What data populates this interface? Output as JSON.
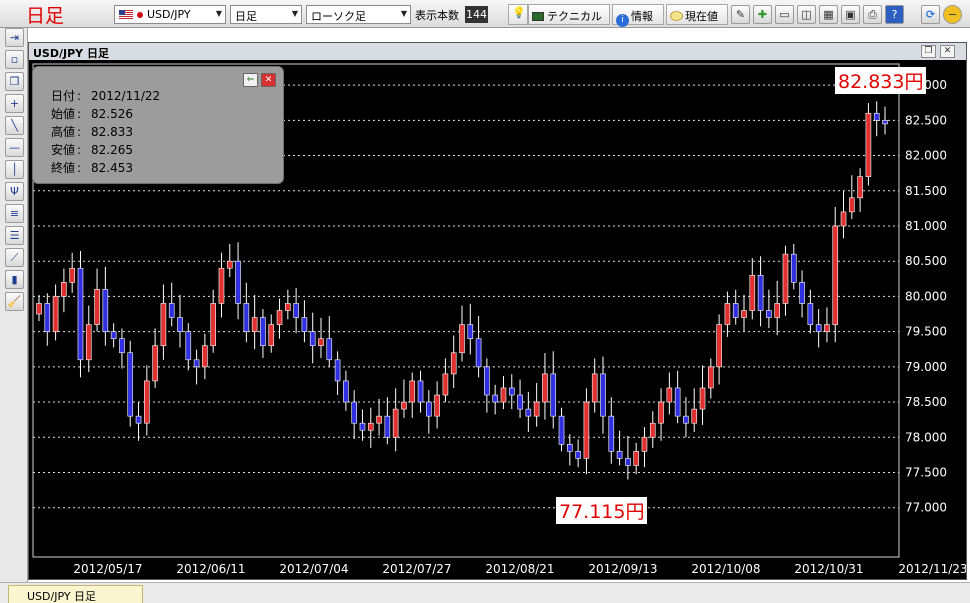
{
  "app": {
    "title": "日足"
  },
  "toolbar": {
    "symbol": "USD/JPY",
    "period": "日足",
    "chart_type": "ローソク足",
    "count_label": "表示本数",
    "count_value": "144",
    "technical_label": "テクニカル",
    "info_label": "情報",
    "current_label": "現在値"
  },
  "chart": {
    "title": "USD/JPY  日足"
  },
  "info_panel": {
    "rows": [
      {
        "key": "日付",
        "value": "2012/11/22"
      },
      {
        "key": "始値",
        "value": "82.526"
      },
      {
        "key": "高値",
        "value": "82.833"
      },
      {
        "key": "安値",
        "value": "82.265"
      },
      {
        "key": "終値",
        "value": "82.453"
      }
    ],
    "separator": ":"
  },
  "annotations": {
    "high_label": "82.833円",
    "low_label": "77.115円"
  },
  "bottom_tab": {
    "label": "USD/JPY  日足"
  },
  "colors": {
    "up": "#e03030",
    "down": "#3030e0",
    "background": "#000000",
    "label": "#e00000"
  },
  "chart_data": {
    "type": "candlestick",
    "ylim": [
      76.3,
      83.3
    ],
    "yticks": [
      "83.000",
      "82.500",
      "82.000",
      "81.500",
      "81.000",
      "80.500",
      "80.000",
      "79.500",
      "79.000",
      "78.500",
      "78.000",
      "77.500",
      "77.000"
    ],
    "xticks": [
      "2012/05/17",
      "2012/06/11",
      "2012/07/04",
      "2012/07/27",
      "2012/08/21",
      "2012/09/13",
      "2012/10/08",
      "2012/10/31",
      "2012/11/23"
    ],
    "closes": [
      79.9,
      79.5,
      80.0,
      80.2,
      80.4,
      79.1,
      79.6,
      80.1,
      79.5,
      79.4,
      79.2,
      78.3,
      78.2,
      78.8,
      79.3,
      79.9,
      79.7,
      79.5,
      79.1,
      79.0,
      79.3,
      79.9,
      80.4,
      80.5,
      79.9,
      79.5,
      79.7,
      79.3,
      79.6,
      79.8,
      79.9,
      79.7,
      79.5,
      79.3,
      79.4,
      79.1,
      78.8,
      78.5,
      78.2,
      78.1,
      78.2,
      78.3,
      78.0,
      78.4,
      78.5,
      78.8,
      78.5,
      78.3,
      78.6,
      78.9,
      79.2,
      79.6,
      79.4,
      79.0,
      78.6,
      78.5,
      78.7,
      78.6,
      78.4,
      78.3,
      78.5,
      78.9,
      78.3,
      77.9,
      77.8,
      77.7,
      78.5,
      78.9,
      78.3,
      77.8,
      77.7,
      77.6,
      77.8,
      78.0,
      78.2,
      78.5,
      78.7,
      78.3,
      78.2,
      78.4,
      78.7,
      79.0,
      79.6,
      79.9,
      79.7,
      79.8,
      80.3,
      79.8,
      79.7,
      79.9,
      80.6,
      80.2,
      79.9,
      79.6,
      79.5,
      79.6,
      81.0,
      81.2,
      81.4,
      81.7,
      82.6,
      82.5,
      82.45
    ]
  }
}
